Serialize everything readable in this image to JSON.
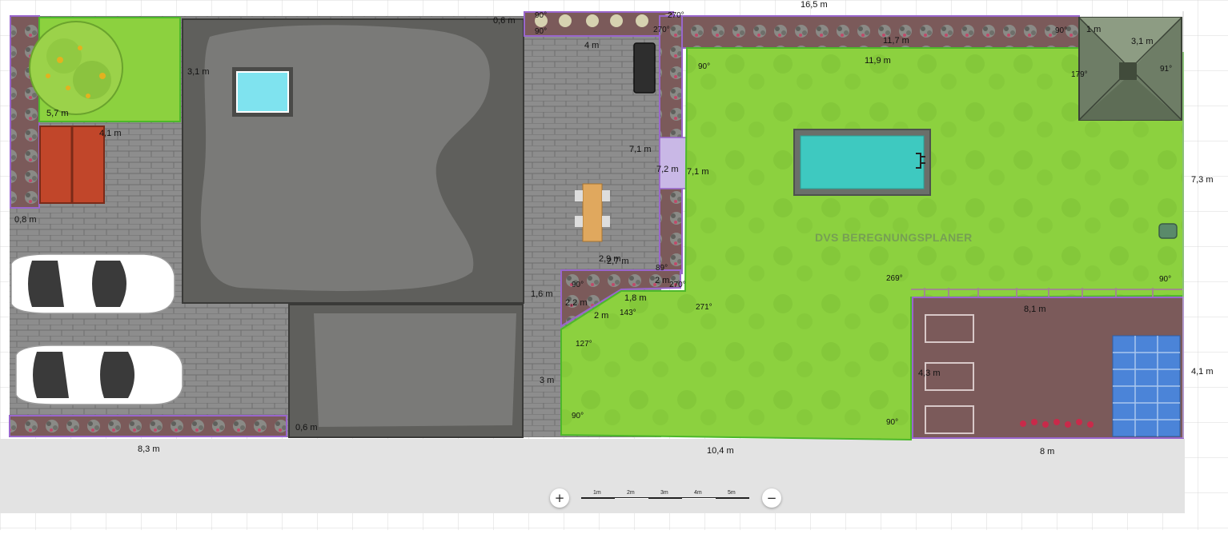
{
  "app": {
    "watermark": "DVS BEREGNUNGSPLANER"
  },
  "colors": {
    "lawn": "#8cd13f",
    "lawn_border": "#4db82a",
    "bed": "#7b5a5a",
    "bed_border": "#9966cc",
    "paving": "#8d8d8d",
    "house": "#5f5f5c",
    "house_inner": "#7a7a78",
    "pool_water": "#3ec9c0",
    "background": "#ffffff",
    "grid_band": "#e3e3e3"
  },
  "dimensions": {
    "total_top": "16,5 m",
    "top_bed_outer": "11,7 m",
    "top_lawn": "11,9 m",
    "gazebo_left": "1 m",
    "gazebo_right": "3,1 m",
    "right_height": "7,3 m",
    "bottom_right_height": "4,1 m",
    "bottom_left": "8,3 m",
    "bottom_mid": "10,4 m",
    "bottom_right": "8 m",
    "house_top_gap": "0,6 m",
    "house_side": "3,1 m",
    "front_lawn": "5,7 m",
    "carport": "4,1 m",
    "left_gap": "0,8 m",
    "terrace_top": "4 m",
    "bed_v1": "7,1 m",
    "bed_v2": "7,2 m",
    "bed_v3": "7,1 m",
    "terrace_bed_a": "2,9 m",
    "terrace_bed_b": "2,7 m",
    "terrace_bed_c": "2 m",
    "terrace_bed_d": "1,8 m",
    "terrace_bed_e": "2,2 m",
    "terrace_bed_f": "2 m",
    "terrace_left": "1,6 m",
    "terrace_bottom": "3 m",
    "garage_gap": "0,6 m",
    "veg_top": "8,1 m",
    "veg_side": "4,3 m"
  },
  "angles": {
    "a1": "90°",
    "a2": "90°",
    "a3": "270°",
    "a4": "270°",
    "a5": "90°",
    "a6": "90°",
    "a7": "179°",
    "a8": "91°",
    "a9": "269°",
    "a10": "90°",
    "a11": "89°",
    "a12": "270°",
    "a13": "271°",
    "a14": "90°",
    "a15": "143°",
    "a16": "127°",
    "a17": "90°",
    "a18": "90°"
  },
  "scale_bar": {
    "labels": [
      "1m",
      "2m",
      "3m",
      "4m",
      "5m"
    ]
  },
  "controls": {
    "zoom_in": "+",
    "zoom_out": "−"
  }
}
